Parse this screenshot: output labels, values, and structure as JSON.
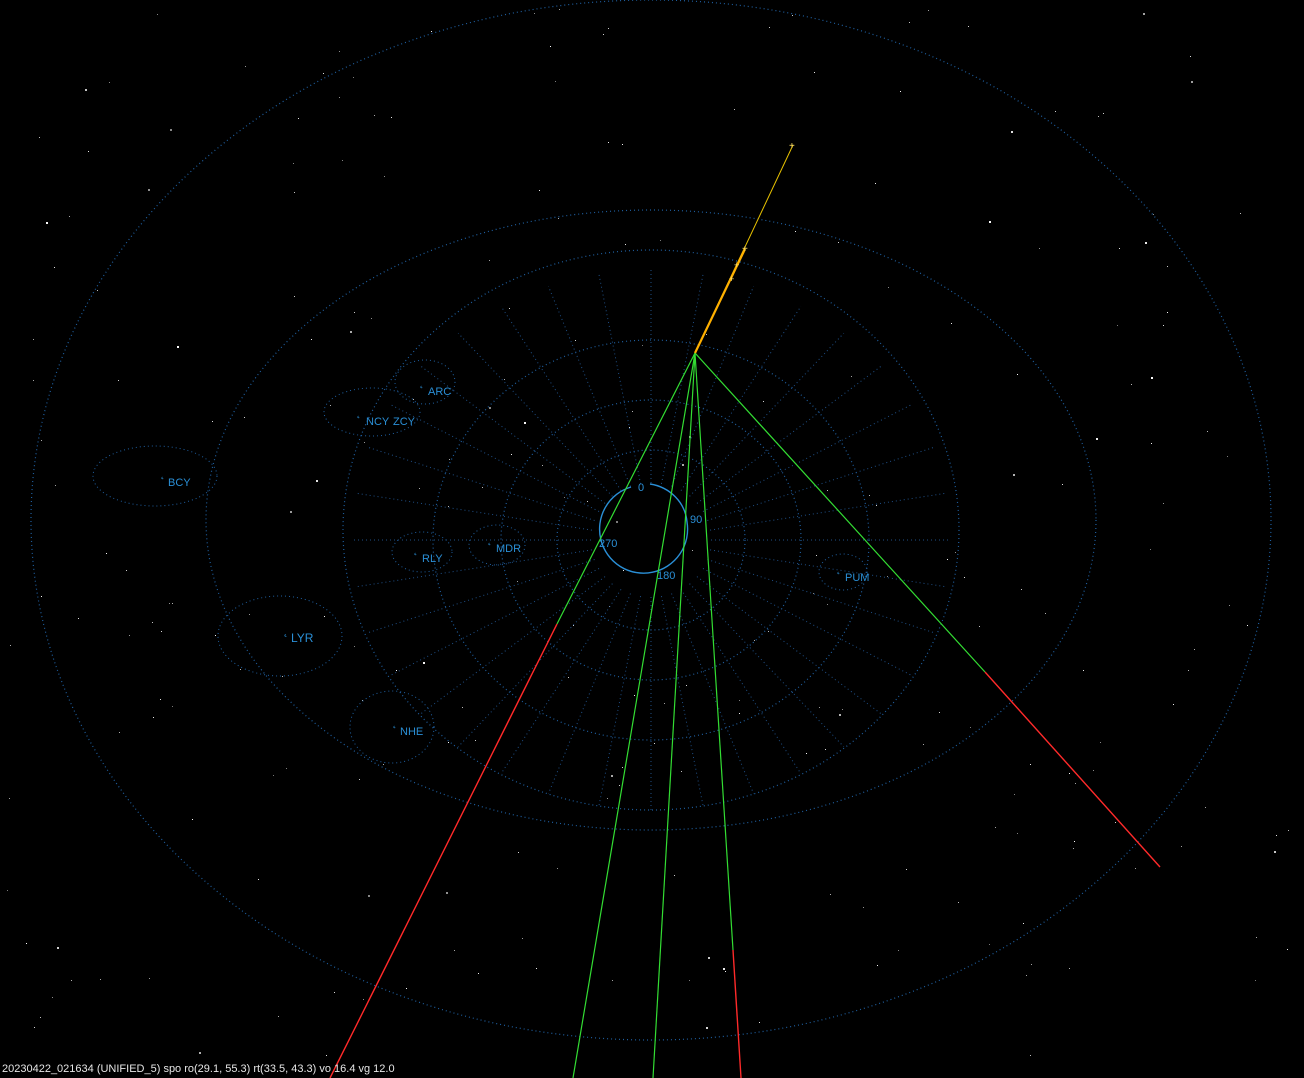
{
  "status_text": "20230422_021634 (UNIFIED_5) spo ro(29.1, 55.3) rt(33.5, 43.3) vo 16.4 vg 12.0",
  "compass_labels": [
    "0",
    "90",
    "180",
    "270"
  ],
  "showers": [
    {
      "name": "ARC"
    },
    {
      "name": "NCY"
    },
    {
      "name": "ZCY"
    },
    {
      "name": "BCY"
    },
    {
      "name": "RLY"
    },
    {
      "name": "MDR"
    },
    {
      "name": "PUM"
    },
    {
      "name": "LYR"
    },
    {
      "name": "NHE"
    }
  ],
  "colors": {
    "background": "#000000",
    "grid": "#1f5fa0",
    "label": "#2a8fd6",
    "trajectory_green": "#33dd33",
    "trajectory_red": "#ff2a2a",
    "meteor_track": "#ffb000",
    "status_text": "#e6e6e6"
  }
}
